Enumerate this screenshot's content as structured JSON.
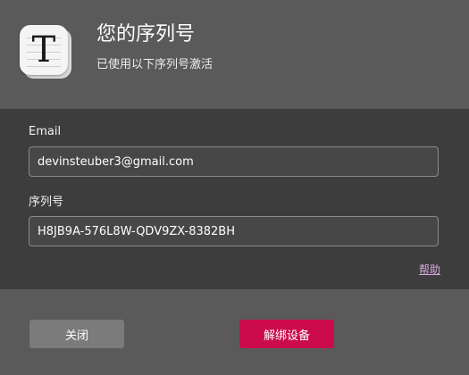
{
  "header": {
    "app_icon_glyph": "T",
    "title": "您的序列号",
    "subtitle": "已使用以下序列号激活"
  },
  "form": {
    "email_label": "Email",
    "email_value": "devinsteuber3@gmail.com",
    "serial_label": "序列号",
    "serial_value": "H8JB9A-576L8W-QDV9ZX-8382BH",
    "help_link": "帮助"
  },
  "footer": {
    "close_label": "关闭",
    "deactivate_label": "解绑设备"
  },
  "colors": {
    "header_bg": "#5a5a5a",
    "form_bg": "#3d3d3d",
    "accent": "#cc0b4d",
    "link": "#d9a7e3"
  }
}
